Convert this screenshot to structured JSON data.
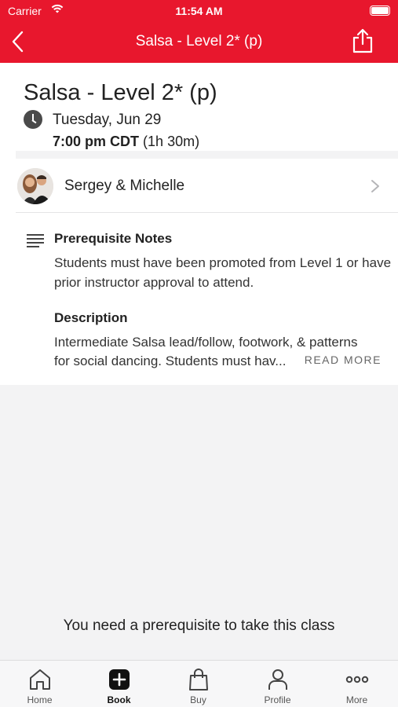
{
  "status_bar": {
    "carrier": "Carrier",
    "time": "11:54 AM"
  },
  "nav": {
    "title": "Salsa - Level 2* (p)"
  },
  "class": {
    "title": "Salsa - Level 2* (p)",
    "date": "Tuesday, Jun 29",
    "time": "7:00 pm CDT",
    "duration": "(1h 30m)"
  },
  "instructor": {
    "name": "Sergey & Michelle"
  },
  "prerequisite": {
    "heading": "Prerequisite Notes",
    "body": "Students must have been promoted from Level 1 or have prior instructor approval to attend."
  },
  "description": {
    "heading": "Description",
    "line1": "Intermediate Salsa lead/follow, footwork, & patterns",
    "line2": "for social dancing. Students must hav...",
    "read_more": "READ MORE"
  },
  "message": "You need a prerequisite to take this class",
  "tabs": [
    {
      "label": "Home",
      "icon": "home-icon"
    },
    {
      "label": "Book",
      "icon": "book-plus-icon",
      "active": true
    },
    {
      "label": "Buy",
      "icon": "shopping-bag-icon"
    },
    {
      "label": "Profile",
      "icon": "person-icon"
    },
    {
      "label": "More",
      "icon": "more-dots-icon"
    }
  ],
  "colors": {
    "brand": "#e8172d"
  }
}
